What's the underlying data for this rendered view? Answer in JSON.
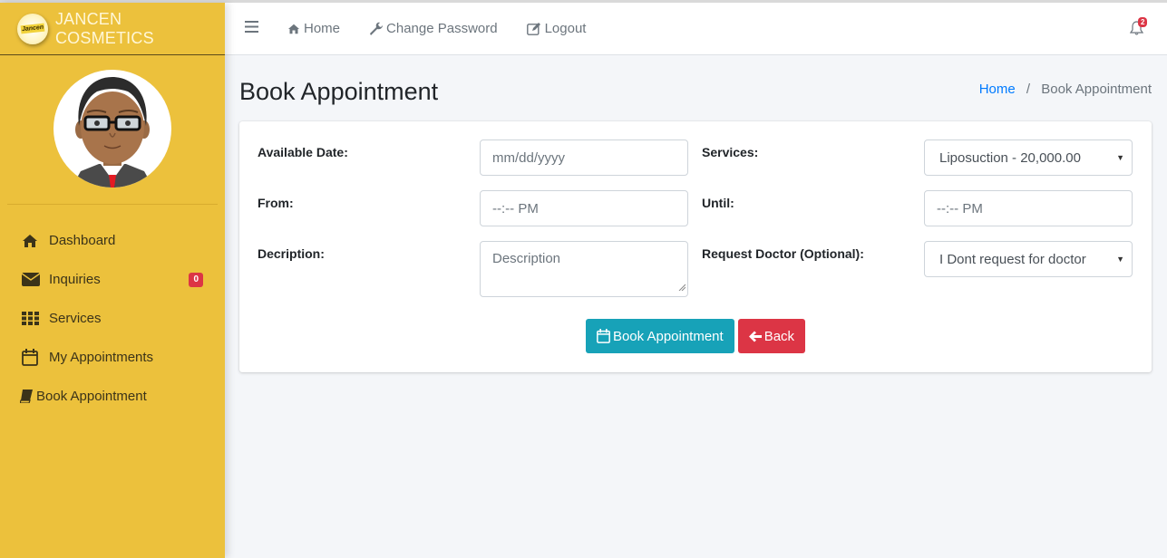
{
  "brand": {
    "name": "JANCEN COSMETICS",
    "logo_text": "Jancen"
  },
  "sidebar": {
    "items": [
      {
        "label": "Dashboard",
        "icon": "home-icon"
      },
      {
        "label": "Inquiries",
        "icon": "envelope-icon",
        "badge": "0"
      },
      {
        "label": "Services",
        "icon": "grid-icon"
      },
      {
        "label": "My Appointments",
        "icon": "calendar-icon"
      },
      {
        "label": "Book Appointment",
        "icon": "book-icon"
      }
    ]
  },
  "topbar": {
    "menu_icon": "hamburger-icon",
    "links": [
      {
        "label": "Home",
        "icon": "home-icon"
      },
      {
        "label": "Change Password",
        "icon": "wrench-icon"
      },
      {
        "label": "Logout",
        "icon": "edit-icon"
      }
    ],
    "notifications_count": "2"
  },
  "page": {
    "title": "Book Appointment",
    "breadcrumb": {
      "home": "Home",
      "separator": "/",
      "current": "Book Appointment"
    }
  },
  "form": {
    "available_date": {
      "label": "Available Date:",
      "placeholder": "mm/dd/yyyy"
    },
    "services": {
      "label": "Services:",
      "selected": "Liposuction - 20,000.00"
    },
    "from": {
      "label": "From:",
      "placeholder": "--:-- PM"
    },
    "until": {
      "label": "Until:",
      "placeholder": "--:-- PM"
    },
    "description": {
      "label": "Decription:",
      "placeholder": "Description"
    },
    "request_doctor": {
      "label": "Request Doctor (Optional):",
      "selected": "I Dont request for doctor"
    },
    "submit_label": "Book Appointment",
    "back_label": "Back"
  },
  "colors": {
    "sidebar_bg": "#ecc13c",
    "primary_info": "#17a2b8",
    "danger": "#dc3545",
    "link": "#007bff"
  }
}
